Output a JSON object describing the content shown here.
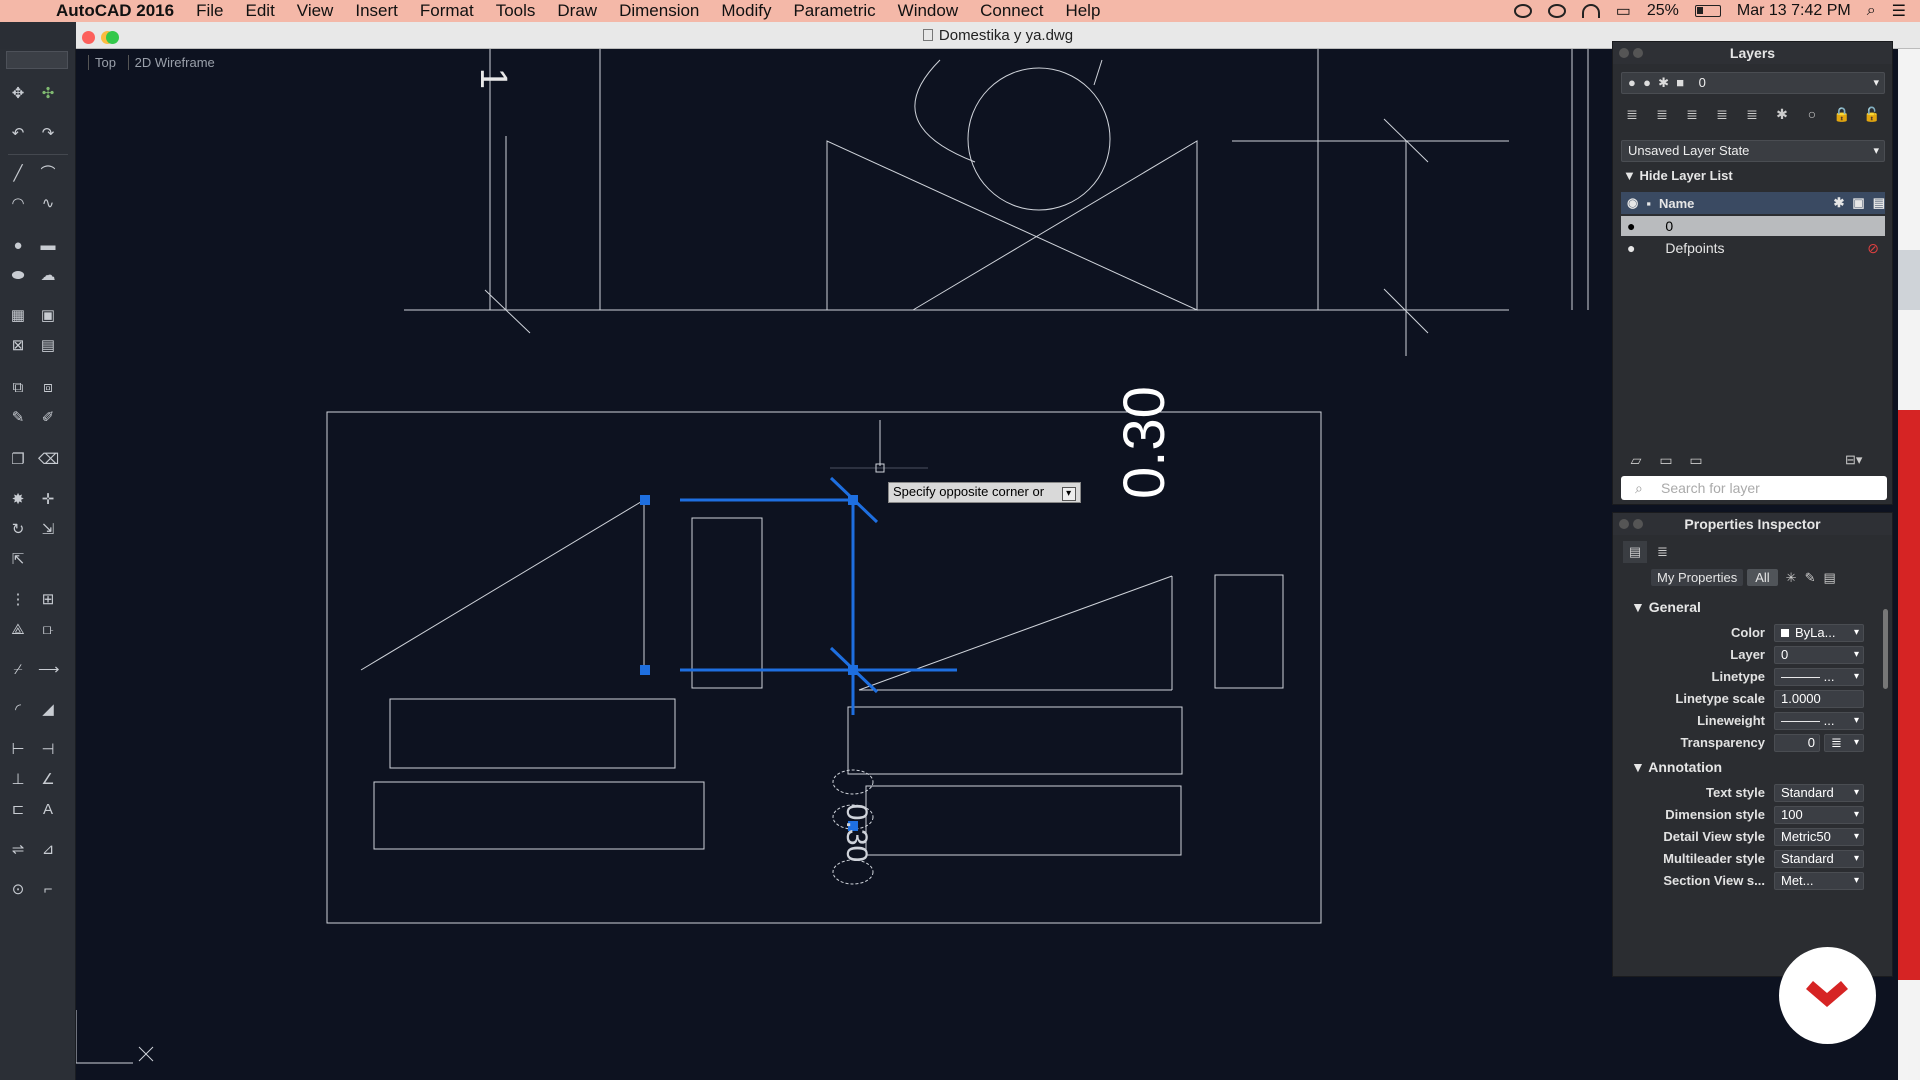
{
  "menubar": {
    "app_name": "AutoCAD 2016",
    "items": [
      "File",
      "Edit",
      "View",
      "Insert",
      "Format",
      "Tools",
      "Draw",
      "Dimension",
      "Modify",
      "Parametric",
      "Window",
      "Connect",
      "Help"
    ],
    "battery": "25%",
    "clock": "Mar 13  7:42 PM"
  },
  "window": {
    "title": "Domestika  y ya.dwg"
  },
  "viewport": {
    "view": "Top",
    "style": "2D Wireframe"
  },
  "canvas": {
    "tooltip": "Specify opposite corner or",
    "dim_text_large": "0.30",
    "dim_text_small": "0.30",
    "corner_mark": "1"
  },
  "layers_panel": {
    "title": "Layers",
    "current_layer": "0",
    "layer_state": "Unsaved Layer State",
    "hide_list_label": "Hide Layer List",
    "name_header": "Name",
    "layers": [
      "0",
      "Defpoints"
    ],
    "search_placeholder": "Search for layer"
  },
  "properties_panel": {
    "title": "Properties Inspector",
    "tab_my": "My Properties",
    "tab_all": "All",
    "general_label": "General",
    "general": [
      {
        "label": "Color",
        "value": "ByLa..."
      },
      {
        "label": "Layer",
        "value": "0"
      },
      {
        "label": "Linetype",
        "value": "——— ..."
      },
      {
        "label": "Linetype scale",
        "value": "1.0000"
      },
      {
        "label": "Lineweight",
        "value": "——— ..."
      },
      {
        "label": "Transparency",
        "value": "0"
      }
    ],
    "annotation_label": "Annotation",
    "annotation": [
      {
        "label": "Text style",
        "value": "Standard"
      },
      {
        "label": "Dimension style",
        "value": "100"
      },
      {
        "label": "Detail View style",
        "value": "Metric50"
      },
      {
        "label": "Multileader style",
        "value": "Standard"
      },
      {
        "label": "Section View s...",
        "value": "Met..."
      }
    ]
  },
  "colors": {
    "selection_blue": "#1e6fe0",
    "canvas_bg": "#0d1220",
    "menubar_bg": "#f4b8a8"
  }
}
